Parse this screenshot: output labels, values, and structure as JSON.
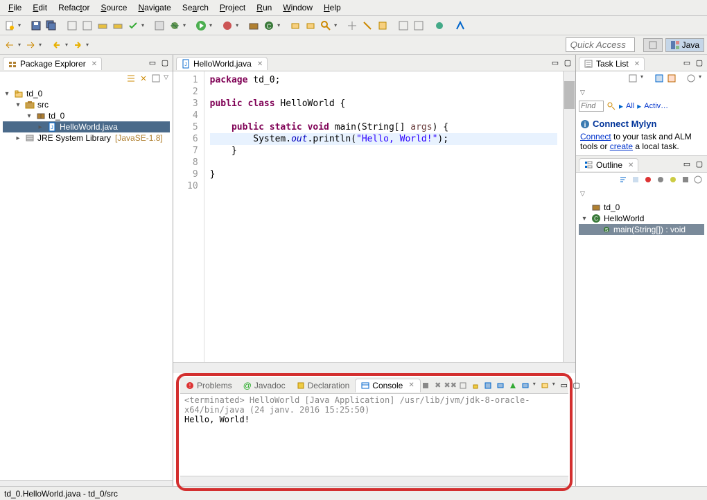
{
  "menu": {
    "file": "File",
    "edit": "Edit",
    "refactor": "Refactor",
    "source": "Source",
    "navigate": "Navigate",
    "search": "Search",
    "project": "Project",
    "run": "Run",
    "window": "Window",
    "help": "Help"
  },
  "quick_access_placeholder": "Quick Access",
  "perspective": {
    "java": "Java"
  },
  "package_explorer": {
    "title": "Package Explorer",
    "items": {
      "project": "td_0",
      "src": "src",
      "pkg": "td_0",
      "file": "HelloWorld.java",
      "jre": "JRE System Library",
      "jre_decor": "[JavaSE-1.8]"
    }
  },
  "editor": {
    "tab": "HelloWorld.java",
    "lines": [
      "1",
      "2",
      "3",
      "4",
      "5",
      "6",
      "7",
      "8",
      "9",
      "10"
    ],
    "code": {
      "l1_kw": "package",
      "l1_rest": " td_0;",
      "l3_kw1": "public",
      "l3_kw2": "class",
      "l3_rest": " HelloWorld {",
      "l5_kw1": "public",
      "l5_kw2": "static",
      "l5_kw3": "void",
      "l5_main": " main(String[] ",
      "l5_args": "args",
      "l5_end": ") {",
      "l6_pre": "        System.",
      "l6_out": "out",
      "l6_mid": ".println(",
      "l6_str": "\"Hello, World!\"",
      "l6_end": ");",
      "l7": "    }",
      "l9": "}"
    }
  },
  "tasklist": {
    "title": "Task List",
    "find": "Find",
    "all": "All",
    "activ": "Activ…",
    "connect_title": "Connect Mylyn",
    "connect_link": "Connect",
    "connect_text1": " to your task and ALM tools or ",
    "create_link": "create",
    "connect_text2": " a local task."
  },
  "outline": {
    "title": "Outline",
    "pkg": "td_0",
    "class": "HelloWorld",
    "method": "main(String[]) : void"
  },
  "bottom": {
    "problems": "Problems",
    "javadoc": "Javadoc",
    "declaration": "Declaration",
    "console": "Console",
    "header": "<terminated> HelloWorld [Java Application] /usr/lib/jvm/jdk-8-oracle-x64/bin/java (24 janv. 2016 15:25:50)",
    "output": "Hello, World!"
  },
  "statusbar": "td_0.HelloWorld.java - td_0/src"
}
